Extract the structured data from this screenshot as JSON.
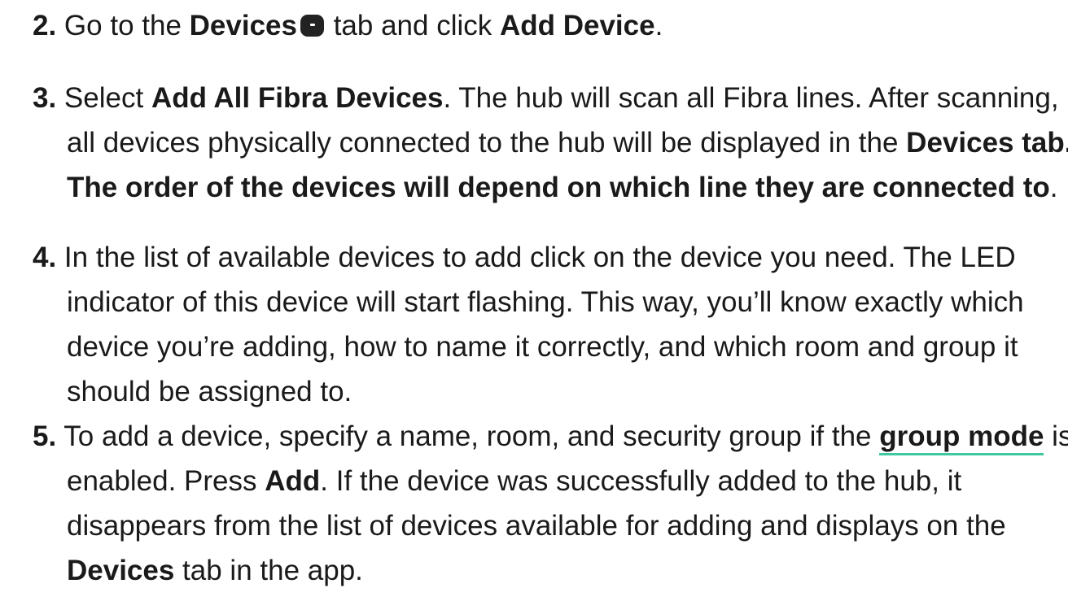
{
  "steps": [
    {
      "num": "2.",
      "l1": {
        "a": " Go to the ",
        "b1": "Devices",
        "c": " tab and click ",
        "b2": "Add Device",
        "d": "."
      }
    },
    {
      "num": "3.",
      "l1": {
        "a": " Select ",
        "b1": "Add All Fibra Devices",
        "c": ". The hub will scan all Fibra lines. After scanning,"
      },
      "l2": {
        "a": "all devices physically connected to the hub will be displayed in the ",
        "b1": "Devices tab."
      },
      "l3": {
        "b1": "The order of the devices will depend on which line they are connected to",
        "d": "."
      }
    },
    {
      "num": "4.",
      "lines": [
        " In the list of available devices to add click on the device you need. The LED",
        "indicator of this device will start flashing. This way, you’ll know exactly which",
        "device you’re adding, how to name it correctly, and which room and group it",
        "should be assigned to."
      ]
    },
    {
      "num": "5.",
      "l1": {
        "a": " To add a device, specify a name, room, and security group if the ",
        "link": "group mode",
        "c": " is"
      },
      "l2": {
        "a": "enabled. Press ",
        "b1": "Add",
        "c": ". If the device was successfully added to the hub, it"
      },
      "l3": {
        "a": "disappears from the list of devices available for adding and displays on the"
      },
      "l4": {
        "b1": "Devices",
        "c": " tab in the app."
      }
    }
  ],
  "icons": {
    "devices_tab": "devices-tab-icon"
  },
  "colors": {
    "text": "#1a1a1a",
    "link_underline": "#3ec8a0",
    "icon_bg": "#222222"
  }
}
